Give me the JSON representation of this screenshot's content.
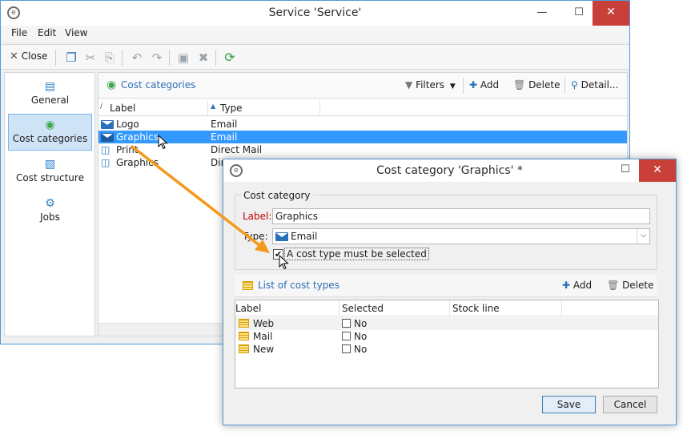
{
  "main_window": {
    "title": "Service 'Service'",
    "menu": [
      "File",
      "Edit",
      "View"
    ],
    "toolbar": {
      "close_label": "Close"
    },
    "sidebar": [
      {
        "label": "General",
        "icon": "clipboard-icon"
      },
      {
        "label": "Cost categories",
        "icon": "money-pin-icon",
        "active": true
      },
      {
        "label": "Cost structure",
        "icon": "structure-icon"
      },
      {
        "label": "Jobs",
        "icon": "gears-icon"
      }
    ],
    "panel": {
      "title": "Cost categories",
      "filters_label": "Filters",
      "add_label": "Add",
      "delete_label": "Delete",
      "detail_label": "Detail...",
      "columns": [
        "Label",
        "Type"
      ],
      "rows": [
        {
          "label": "Logo",
          "type": "Email",
          "icon": "email-icon"
        },
        {
          "label": "Graphics",
          "type": "Email",
          "icon": "email-icon",
          "selected": true
        },
        {
          "label": "Print",
          "type": "Direct Mail",
          "icon": "direct-mail-icon"
        },
        {
          "label": "Graphics",
          "type": "Dir",
          "icon": "direct-mail-icon"
        }
      ]
    }
  },
  "dialog": {
    "title": "Cost category 'Graphics' *",
    "group_label": "Cost category",
    "label_field": {
      "label": "Label:",
      "value": "Graphics"
    },
    "type_field": {
      "label": "Type:",
      "value": "Email"
    },
    "checkbox": {
      "label": "A cost type must be selected",
      "checked": true
    },
    "list": {
      "title": "List of cost types",
      "add_label": "Add",
      "delete_label": "Delete",
      "columns": [
        "Label",
        "Selected",
        "Stock line"
      ],
      "rows": [
        {
          "label": "Web",
          "selected": "No"
        },
        {
          "label": "Mail",
          "selected": "No"
        },
        {
          "label": "New",
          "selected": "No"
        }
      ]
    },
    "save_label": "Save",
    "cancel_label": "Cancel"
  },
  "colors": {
    "accent": "#3399ff",
    "link": "#2e6db4",
    "arrow": "#f39a1e",
    "required_label": "#c00000"
  }
}
